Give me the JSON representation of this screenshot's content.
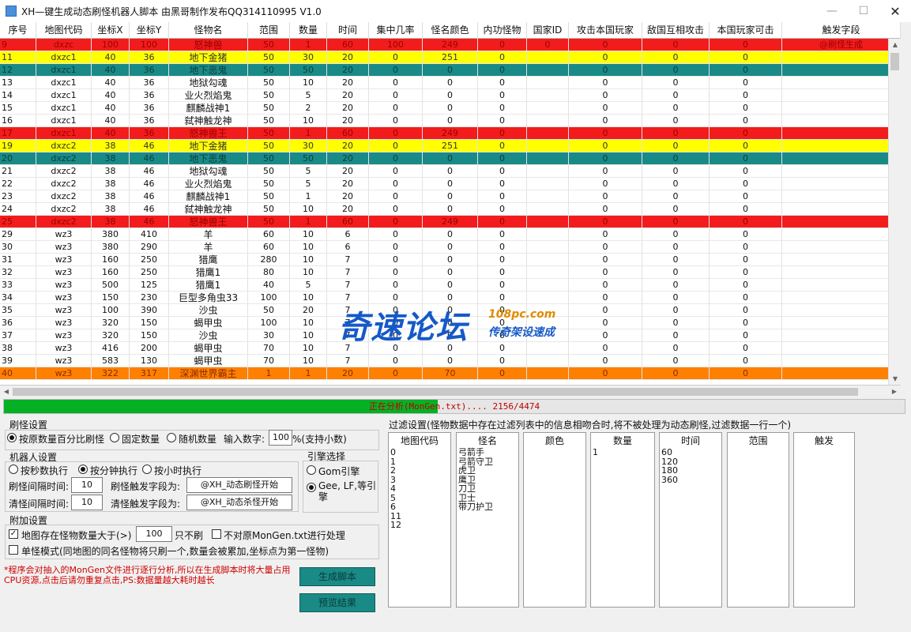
{
  "window": {
    "title": "XH—键生成动态刷怪机器人脚本 由黑哥制作发布QQ314110995 V1.0",
    "minimize_icon": "minimize-icon",
    "maximize_icon": "maximize-icon",
    "close_icon": "close-icon"
  },
  "table": {
    "headers": [
      "序号",
      "地图代码",
      "坐标X",
      "坐标Y",
      "怪物名",
      "范围",
      "数量",
      "时间",
      "集中几率",
      "怪名颜色",
      "内功怪物",
      "国家ID",
      "攻击本国玩家",
      "敌国互相攻击",
      "本国玩家可击",
      "触发字段"
    ],
    "rows": [
      {
        "style": "red",
        "cells": [
          "9",
          "dxzc",
          "100",
          "100",
          "怒神兽",
          "50",
          "1",
          "60",
          "100",
          "249",
          "0",
          "0",
          "0",
          "0",
          "0",
          "@刷怪生成"
        ]
      },
      {
        "style": "yellow",
        "cells": [
          "11",
          "dxzc1",
          "40",
          "36",
          "地下金猪",
          "50",
          "30",
          "20",
          "0",
          "251",
          "0",
          "",
          "0",
          "0",
          "0",
          ""
        ]
      },
      {
        "style": "teal",
        "cells": [
          "12",
          "dxzc1",
          "40",
          "36",
          "地下恶鬼",
          "50",
          "50",
          "20",
          "0",
          "0",
          "0",
          "",
          "0",
          "0",
          "0",
          ""
        ]
      },
      {
        "style": "white",
        "cells": [
          "13",
          "dxzc1",
          "40",
          "36",
          "地狱勾魂",
          "50",
          "10",
          "20",
          "0",
          "0",
          "0",
          "",
          "0",
          "0",
          "0",
          ""
        ]
      },
      {
        "style": "white",
        "cells": [
          "14",
          "dxzc1",
          "40",
          "36",
          "业火烈焰鬼",
          "50",
          "5",
          "20",
          "0",
          "0",
          "0",
          "",
          "0",
          "0",
          "0",
          ""
        ]
      },
      {
        "style": "white",
        "cells": [
          "15",
          "dxzc1",
          "40",
          "36",
          "麒麟战神1",
          "50",
          "2",
          "20",
          "0",
          "0",
          "0",
          "",
          "0",
          "0",
          "0",
          ""
        ]
      },
      {
        "style": "white",
        "cells": [
          "16",
          "dxzc1",
          "40",
          "36",
          "弑神触龙神",
          "50",
          "10",
          "20",
          "0",
          "0",
          "0",
          "",
          "0",
          "0",
          "0",
          ""
        ]
      },
      {
        "style": "red",
        "cells": [
          "17",
          "dxzc1",
          "40",
          "36",
          "怒神兽王",
          "50",
          "1",
          "60",
          "0",
          "249",
          "0",
          "",
          "0",
          "0",
          "0",
          ""
        ]
      },
      {
        "style": "yellow",
        "cells": [
          "19",
          "dxzc2",
          "38",
          "46",
          "地下金猪",
          "50",
          "30",
          "20",
          "0",
          "251",
          "0",
          "",
          "0",
          "0",
          "0",
          ""
        ]
      },
      {
        "style": "teal",
        "cells": [
          "20",
          "dxzc2",
          "38",
          "46",
          "地下恶鬼",
          "50",
          "50",
          "20",
          "0",
          "0",
          "0",
          "",
          "0",
          "0",
          "0",
          ""
        ]
      },
      {
        "style": "white",
        "cells": [
          "21",
          "dxzc2",
          "38",
          "46",
          "地狱勾魂",
          "50",
          "5",
          "20",
          "0",
          "0",
          "0",
          "",
          "0",
          "0",
          "0",
          ""
        ]
      },
      {
        "style": "white",
        "cells": [
          "22",
          "dxzc2",
          "38",
          "46",
          "业火烈焰鬼",
          "50",
          "5",
          "20",
          "0",
          "0",
          "0",
          "",
          "0",
          "0",
          "0",
          ""
        ]
      },
      {
        "style": "white",
        "cells": [
          "23",
          "dxzc2",
          "38",
          "46",
          "麒麟战神1",
          "50",
          "1",
          "20",
          "0",
          "0",
          "0",
          "",
          "0",
          "0",
          "0",
          ""
        ]
      },
      {
        "style": "white",
        "cells": [
          "24",
          "dxzc2",
          "38",
          "46",
          "弑神触龙神",
          "50",
          "10",
          "20",
          "0",
          "0",
          "0",
          "",
          "0",
          "0",
          "0",
          ""
        ]
      },
      {
        "style": "red",
        "cells": [
          "25",
          "dxzc2",
          "38",
          "46",
          "怒神兽王",
          "50",
          "1",
          "60",
          "0",
          "249",
          "0",
          "",
          "0",
          "0",
          "0",
          ""
        ]
      },
      {
        "style": "white",
        "cells": [
          "29",
          "wz3",
          "380",
          "410",
          "羊",
          "60",
          "10",
          "6",
          "0",
          "0",
          "0",
          "",
          "0",
          "0",
          "0",
          ""
        ]
      },
      {
        "style": "white",
        "cells": [
          "30",
          "wz3",
          "380",
          "290",
          "羊",
          "60",
          "10",
          "6",
          "0",
          "0",
          "0",
          "",
          "0",
          "0",
          "0",
          ""
        ]
      },
      {
        "style": "white",
        "cells": [
          "31",
          "wz3",
          "160",
          "250",
          "猎鹰",
          "280",
          "10",
          "7",
          "0",
          "0",
          "0",
          "",
          "0",
          "0",
          "0",
          ""
        ]
      },
      {
        "style": "white",
        "cells": [
          "32",
          "wz3",
          "160",
          "250",
          "猎鹰1",
          "80",
          "10",
          "7",
          "0",
          "0",
          "0",
          "",
          "0",
          "0",
          "0",
          ""
        ]
      },
      {
        "style": "white",
        "cells": [
          "33",
          "wz3",
          "500",
          "125",
          "猎鹰1",
          "40",
          "5",
          "7",
          "0",
          "0",
          "0",
          "",
          "0",
          "0",
          "0",
          ""
        ]
      },
      {
        "style": "white",
        "cells": [
          "34",
          "wz3",
          "150",
          "230",
          "巨型多角虫33",
          "100",
          "10",
          "7",
          "0",
          "0",
          "0",
          "",
          "0",
          "0",
          "0",
          ""
        ]
      },
      {
        "style": "white",
        "cells": [
          "35",
          "wz3",
          "100",
          "390",
          "沙虫",
          "50",
          "20",
          "7",
          "0",
          "0",
          "0",
          "",
          "0",
          "0",
          "0",
          ""
        ]
      },
      {
        "style": "white",
        "cells": [
          "36",
          "wz3",
          "320",
          "150",
          "蝎甲虫",
          "100",
          "10",
          "7",
          "0",
          "0",
          "0",
          "",
          "0",
          "0",
          "0",
          ""
        ]
      },
      {
        "style": "white",
        "cells": [
          "37",
          "wz3",
          "320",
          "150",
          "沙虫",
          "30",
          "10",
          "7",
          "0",
          "0",
          "0",
          "",
          "0",
          "0",
          "0",
          ""
        ]
      },
      {
        "style": "white",
        "cells": [
          "38",
          "wz3",
          "416",
          "200",
          "蝎甲虫",
          "70",
          "10",
          "7",
          "0",
          "0",
          "0",
          "",
          "0",
          "0",
          "0",
          ""
        ]
      },
      {
        "style": "white",
        "cells": [
          "39",
          "wz3",
          "583",
          "130",
          "蝎甲虫",
          "70",
          "10",
          "7",
          "0",
          "0",
          "0",
          "",
          "0",
          "0",
          "0",
          ""
        ]
      },
      {
        "style": "orange",
        "cells": [
          "40",
          "wz3",
          "322",
          "317",
          "深渊世界霸主",
          "1",
          "1",
          "20",
          "0",
          "70",
          "0",
          "",
          "0",
          "0",
          "0",
          ""
        ]
      }
    ]
  },
  "progress": {
    "text": "正在分析(MonGen.txt)....  2156/4474",
    "current": 2156,
    "total": 4474
  },
  "settings": {
    "spawn_group_title": "刷怪设置",
    "spawn_mode_options": [
      "按原数量百分比刷怪",
      "固定数量",
      "随机数量"
    ],
    "spawn_mode_selected": 0,
    "input_number_label": "输入数字:",
    "input_number_value": "100",
    "percent_hint": "%(支持小数)",
    "robot_group_title": "机器人设置",
    "robot_exec_options": [
      "按秒数执行",
      "按分钟执行",
      "按小时执行"
    ],
    "robot_exec_selected": 1,
    "spawn_interval_label": "刷怪间隔时间:",
    "spawn_interval_value": "10",
    "spawn_trigger_label": "刷怪触发字段为:",
    "spawn_trigger_value": "@XH_动态刷怪开始",
    "clear_interval_label": "清怪间隔时间:",
    "clear_interval_value": "10",
    "clear_trigger_label": "清怪触发字段为:",
    "clear_trigger_value": "@XH_动态杀怪开始",
    "engine_group_title": "引擎选择",
    "engine_options": [
      "Gom引擎",
      "Gee, LF,等引擎"
    ],
    "engine_selected": 1,
    "extra_group_title": "附加设置",
    "extra_check1_label": "地图存在怪物数量大于(>)",
    "extra_check1_checked": true,
    "extra_check1_value": "100",
    "extra_check1_suffix": "只不刷",
    "extra_check2_label": "不对原MonGen.txt进行处理",
    "extra_check2_checked": false,
    "extra_check3_label": "单怪模式(同地图的同名怪物将只刷一个,数量会被累加,坐标点为第一怪物)",
    "extra_check3_checked": false,
    "note": "*程序会对抽入的MonGen文件进行逐行分析,所以在生成脚本时将大量占用CPU资源,点击后请勿重复点击,PS:数据量越大耗时越长",
    "generate_button": "生成脚本",
    "preview_button": "预览结果"
  },
  "filter": {
    "title": "过滤设置(怪物数据中存在过滤列表中的信息相吻合时,将不被处理为动态刷怪,过滤数据一行一个)",
    "columns": [
      {
        "header": "地图代码",
        "items": [
          "0",
          "1",
          "2",
          "3",
          "4",
          "5",
          "6",
          "11",
          "12"
        ]
      },
      {
        "header": "怪名",
        "items": [
          "弓箭手",
          "弓箭守卫",
          "虎卫",
          "鹰卫",
          "刀卫",
          "卫士",
          "带刀护卫"
        ]
      },
      {
        "header": "颜色",
        "items": []
      },
      {
        "header": "数量",
        "items": [
          "1"
        ]
      },
      {
        "header": "时间",
        "items": [
          "60",
          "120",
          "180",
          "360"
        ]
      },
      {
        "header": "范围",
        "items": []
      },
      {
        "header": "触发",
        "items": []
      }
    ]
  },
  "watermark": {
    "main": "奇速论坛",
    "url": "108pc.com",
    "sub": "传奇架设速成"
  },
  "colors": {
    "red_row": "#f21c1c",
    "yellow_row": "#ffff00",
    "teal_row": "#1a8a86",
    "orange_row": "#ff8000",
    "progress_fill": "#06b025",
    "button_bg": "#1a8a86"
  }
}
